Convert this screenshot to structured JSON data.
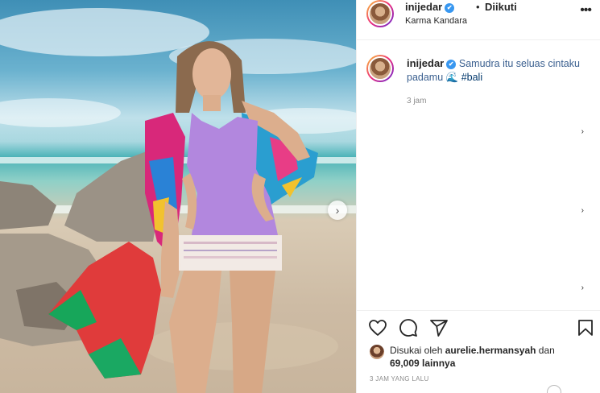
{
  "post": {
    "username": "inijedar",
    "verified_mark": "✔",
    "separator": "•",
    "follow_status": "Diikuti",
    "location": "Karma Kandara",
    "more_label": "•••"
  },
  "caption": {
    "username": "inijedar",
    "text": "Samudra itu seluas cintaku padamu 🌊 ",
    "hashtag": "#bali",
    "time": "3 jam"
  },
  "likes": {
    "prefix": "Disukai oleh",
    "user": "aurelie.hermansyah",
    "mid": "dan",
    "count": "69,009 lainnya"
  },
  "post_time": "3 JAM YANG LALU",
  "icons": {
    "like": "heart-icon",
    "comment": "comment-icon",
    "share": "send-icon",
    "save": "bookmark-icon",
    "next": "chevron-right-icon"
  },
  "carousel_next_label": "›",
  "reply_chevron": "›"
}
